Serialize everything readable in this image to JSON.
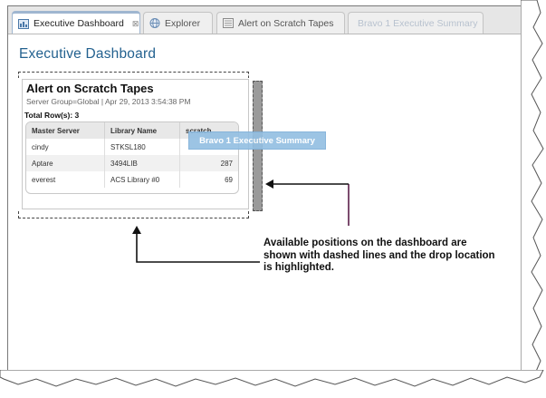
{
  "tabs": [
    {
      "label": "Executive Dashboard",
      "state": "active",
      "icon": "dashboard-icon"
    },
    {
      "label": "Explorer",
      "state": "normal",
      "icon": "globe-icon"
    },
    {
      "label": "Alert on Scratch Tapes",
      "state": "normal",
      "icon": "report-icon"
    },
    {
      "label": "Bravo 1 Executive Summary",
      "state": "dragging"
    }
  ],
  "page_title": "Executive Dashboard",
  "widget": {
    "title": "Alert on Scratch Tapes",
    "subtitle": "Server Group=Global | Apr 29, 2013 3:54:38 PM",
    "total_rows": "Total Row(s): 3",
    "columns": [
      "Master Server",
      "Library Name",
      "scratch"
    ],
    "rows": [
      [
        "cindy",
        "STKSL180",
        ""
      ],
      [
        "Aptare",
        "3494LIB",
        "287"
      ],
      [
        "everest",
        "ACS Library #0",
        "69"
      ]
    ]
  },
  "drag_label": "Bravo 1 Executive Summary",
  "callout": "Available positions on the dashboard are shown with dashed lines and the drop location is highlighted.",
  "colors": {
    "title": "#23618f",
    "active_tab_accent": "#3a6da4",
    "drop_highlight": "#94bfe2",
    "arrow_line": "#5a1e4a"
  }
}
